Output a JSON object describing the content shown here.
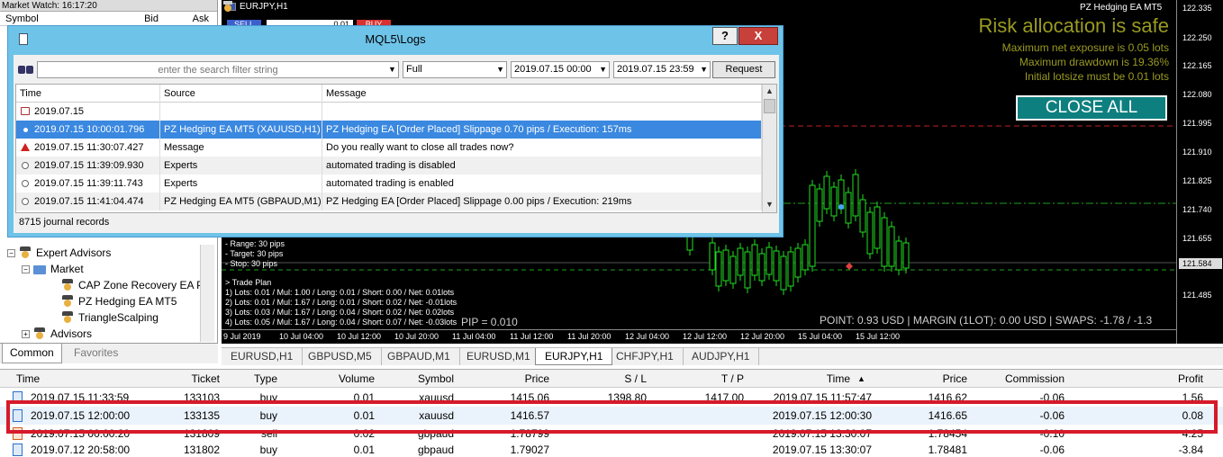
{
  "market_watch": {
    "title": "Market Watch: 16:17:20",
    "columns": [
      "Symbol",
      "Bid",
      "Ask"
    ]
  },
  "navigator": {
    "items": [
      {
        "label": "Expert Advisors",
        "icon": "expert-folder-icon"
      },
      {
        "label": "Market",
        "icon": "folder-icon"
      },
      {
        "label": "CAP Zone Recovery EA P",
        "icon": "expert-icon"
      },
      {
        "label": "PZ Hedging EA MT5",
        "icon": "expert-icon"
      },
      {
        "label": "TriangleScalping",
        "icon": "expert-icon"
      },
      {
        "label": "Advisors",
        "icon": "expert-folder-icon"
      }
    ],
    "tabs": [
      "Common",
      "Favorites"
    ]
  },
  "chart": {
    "symbol": "EURJPY,H1",
    "ea_name": "PZ Hedging EA MT5",
    "sell_label": "SELL",
    "buy_label": "BUY",
    "lot_value": "0.01",
    "risk_title": "Risk allocation is safe",
    "risk_lines": [
      "Maximum net exposure is 0.05 lots",
      "Maximum drawdown is 19.36%",
      "Initial lotsize must be 0.01 lots"
    ],
    "close_all_label": "CLOSE ALL",
    "price_labels": [
      "122.335",
      "122.250",
      "122.165",
      "122.080",
      "121.995",
      "121.910",
      "121.825",
      "121.740",
      "121.655",
      "121.584",
      "121.485"
    ],
    "current_price": "121.584",
    "ea_text": [
      "- Range: 30 pips",
      "- Target: 30 pips",
      "- Stop: 30 pips",
      "> Trade Plan",
      "1) Lots: 0.01 / Mul: 1.00 / Long: 0.01 / Short: 0.00 / Net: 0.01lots",
      "2) Lots: 0.01 / Mul: 1.67 / Long: 0.01 / Short: 0.02 / Net: -0.01lots",
      "3) Lots: 0.03 / Mul: 1.67 / Long: 0.04 / Short: 0.02 / Net: 0.02lots",
      "4) Lots: 0.05 / Mul: 1.67 / Long: 0.04 / Short: 0.07 / Net: -0.03lots"
    ],
    "pip_text": "PIP = 0.010",
    "status_text": "POINT: 0.93 USD | MARGIN (1LOT): 0.00 USD | SWAPS: -1.78 / -1.3",
    "time_labels": [
      "9 Jul 2019",
      "10 Jul 04:00",
      "10 Jul 12:00",
      "10 Jul 20:00",
      "11 Jul 04:00",
      "11 Jul 12:00",
      "11 Jul 20:00",
      "12 Jul 04:00",
      "12 Jul 12:00",
      "12 Jul 20:00",
      "15 Jul 04:00",
      "15 Jul 12:00"
    ]
  },
  "chart_tabs": [
    "EURUSD,H1",
    "GBPUSD,M5",
    "GBPAUD,M1",
    "EURUSD,M1",
    "EURJPY,H1",
    "CHFJPY,H1",
    "AUDJPY,H1"
  ],
  "active_chart_tab": "EURJPY,H1",
  "trades": {
    "columns": [
      "Time",
      "Ticket",
      "Type",
      "Volume",
      "Symbol",
      "Price",
      "S / L",
      "T / P",
      "Time",
      "Price",
      "Commission",
      "Profit"
    ],
    "rows": [
      [
        "2019.07.15 11:33:59",
        "133103",
        "buy",
        "0.01",
        "xauusd",
        "1415.06",
        "1398.80",
        "1417.00",
        "2019.07.15 11:57:47",
        "1416.62",
        "-0.06",
        "1.56"
      ],
      [
        "2019.07.15 12:00:00",
        "133135",
        "buy",
        "0.01",
        "xauusd",
        "1416.57",
        "",
        "",
        "2019.07.15 12:00:30",
        "1416.65",
        "-0.06",
        "0.08"
      ],
      [
        "2019.07.15 00:00:20",
        "131809",
        "sell",
        "0.02",
        "gbpaud",
        "1.78799",
        "",
        "",
        "2019.07.15 13:30:07",
        "1.78454",
        "-0.10",
        "4.25"
      ],
      [
        "2019.07.12 20:58:00",
        "131802",
        "buy",
        "0.01",
        "gbpaud",
        "1.79027",
        "",
        "",
        "2019.07.15 13:30:07",
        "1.78481",
        "-0.06",
        "-3.84"
      ]
    ]
  },
  "logs": {
    "title": "MQL5\\Logs",
    "help_label": "?",
    "close_label": "X",
    "search_placeholder": "enter the search filter string",
    "level": "Full",
    "date_from": "2019.07.15 00:00",
    "date_to": "2019.07.15 23:59",
    "request_label": "Request",
    "columns": [
      "Time",
      "Source",
      "Message"
    ],
    "rows": [
      {
        "time": "2019.07.15",
        "source": "",
        "message": "",
        "icon": "calendar"
      },
      {
        "time": "2019.07.15 10:00:01.796",
        "source": "PZ Hedging EA MT5 (XAUUSD,H1)",
        "message": "PZ Hedging EA [Order Placed] Slippage 0.70 pips / Execution: 157ms",
        "icon": "info"
      },
      {
        "time": "2019.07.15 11:30:07.427",
        "source": "Message",
        "message": "Do you really want to close all trades now?",
        "icon": "warning"
      },
      {
        "time": "2019.07.15 11:39:09.930",
        "source": "Experts",
        "message": "automated trading is disabled",
        "icon": "info"
      },
      {
        "time": "2019.07.15 11:39:11.743",
        "source": "Experts",
        "message": "automated trading is enabled",
        "icon": "info"
      },
      {
        "time": "2019.07.15 11:41:04.474",
        "source": "PZ Hedging EA MT5 (GBPAUD,M1)",
        "message": "PZ Hedging EA [Order Placed] Slippage 0.00 pips / Execution: 219ms",
        "icon": "info"
      }
    ],
    "journal_count": "8715 journal records"
  },
  "colors": {
    "chart_bg": "#000000",
    "candle": "#20e020",
    "risk_text": "#9a9a22",
    "close_all_bg": "#0e7f7f",
    "highlight_box": "#d61a2a",
    "log_selected": "#3a88e0"
  }
}
